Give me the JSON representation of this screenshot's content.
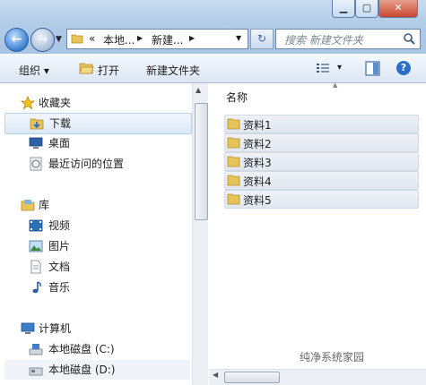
{
  "window": {
    "minimize": "▁",
    "maximize": "▢",
    "close": "✕"
  },
  "address": {
    "root_prefix": "«",
    "seg1": "本地...",
    "seg2": "新建...",
    "sep": "▶"
  },
  "search": {
    "placeholder": "搜索 新建文件夹"
  },
  "toolbar": {
    "organize": "组织 ▾",
    "open": "打开",
    "new_folder": "新建文件夹",
    "view": "▾",
    "help": "?"
  },
  "nav": {
    "favorites": {
      "header": "收藏夹",
      "items": [
        "下载",
        "桌面",
        "最近访问的位置"
      ]
    },
    "libraries": {
      "header": "库",
      "items": [
        "视频",
        "图片",
        "文档",
        "音乐"
      ]
    },
    "computer": {
      "header": "计算机",
      "items": [
        "本地磁盘 (C:)",
        "本地磁盘 (D:)"
      ]
    }
  },
  "content": {
    "column_header": "名称",
    "files": [
      "资料1",
      "资料2",
      "资料3",
      "资料4",
      "资料5"
    ]
  },
  "watermark": "纯净系统家园"
}
